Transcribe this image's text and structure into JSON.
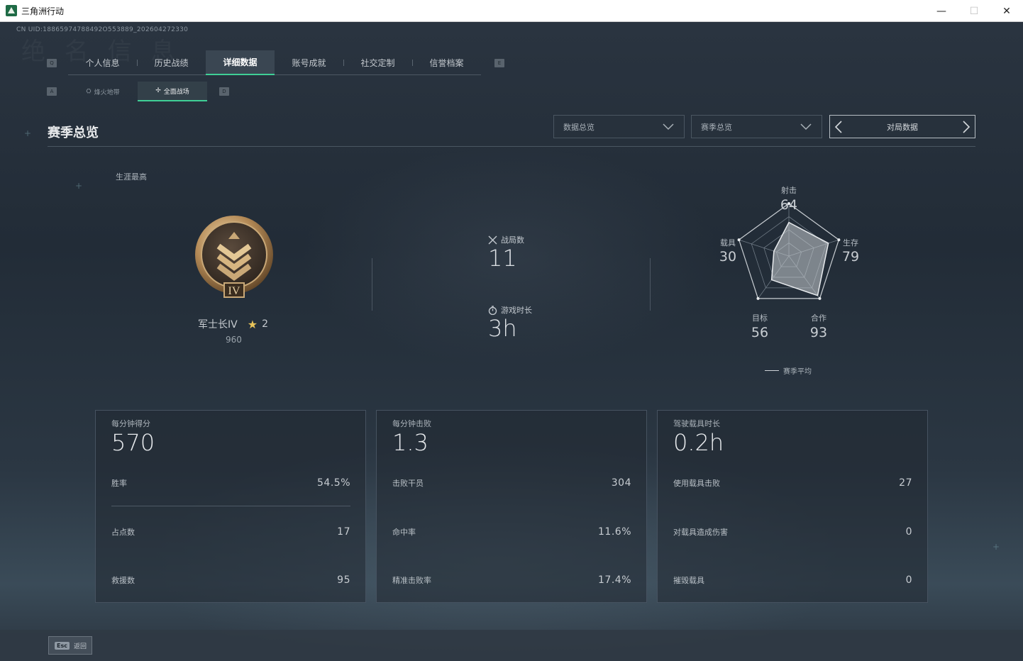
{
  "window": {
    "title": "三角洲行动",
    "minimize": "—",
    "maximize": "☐",
    "close": "✕"
  },
  "uid": "CN UID:18865974788492O553889_202604272330",
  "watermark": "绝 名 信 息",
  "keys": {
    "left_tab": "Q",
    "right_tab": "E",
    "left_sub": "A",
    "right_sub": "D"
  },
  "tabs": [
    {
      "label": "个人信息"
    },
    {
      "label": "历史战绩"
    },
    {
      "label": "详细数据",
      "active": true
    },
    {
      "label": "账号成就"
    },
    {
      "label": "社交定制"
    },
    {
      "label": "信誉档案"
    }
  ],
  "subtabs": [
    {
      "label": "烽火地带"
    },
    {
      "label": "全面战场",
      "active": true
    }
  ],
  "section": {
    "title": "赛季总览",
    "dropdown1": "数据总览",
    "dropdown2": "赛季总览",
    "pager": "对局数据"
  },
  "career": {
    "label": "生涯最高",
    "rank_name": "军士长IV",
    "stars": "2",
    "score": "960",
    "medal_numeral": "IV"
  },
  "summary": {
    "matches_label": "战局数",
    "matches_value": "11",
    "time_label": "游戏时长",
    "time_value": "3h"
  },
  "radar": {
    "axes": [
      {
        "label": "射击",
        "value": "64"
      },
      {
        "label": "生存",
        "value": "79"
      },
      {
        "label": "合作",
        "value": "93"
      },
      {
        "label": "目标",
        "value": "56"
      },
      {
        "label": "载具",
        "value": "30"
      }
    ],
    "scores": [
      64,
      79,
      93,
      56,
      30
    ],
    "legend": "赛季平均"
  },
  "cards": [
    {
      "title": "每分钟得分",
      "value": "570",
      "rows": [
        {
          "k": "胜率",
          "v": "54.5%"
        },
        {
          "k": "占点数",
          "v": "17"
        },
        {
          "k": "救援数",
          "v": "95"
        }
      ]
    },
    {
      "title": "每分钟击败",
      "value": "1.3",
      "rows": [
        {
          "k": "击败干员",
          "v": "304"
        },
        {
          "k": "命中率",
          "v": "11.6%"
        },
        {
          "k": "精准击败率",
          "v": "17.4%"
        }
      ]
    },
    {
      "title": "驾驶载具时长",
      "value": "0.2h",
      "rows": [
        {
          "k": "使用载具击败",
          "v": "27"
        },
        {
          "k": "对载具造成伤害",
          "v": "0"
        },
        {
          "k": "摧毁载具",
          "v": "0"
        }
      ]
    }
  ],
  "footer": {
    "esc_key": "Esc",
    "esc_label": "返回"
  },
  "colors": {
    "accent": "#3fcf96",
    "star": "#e8c45a"
  }
}
